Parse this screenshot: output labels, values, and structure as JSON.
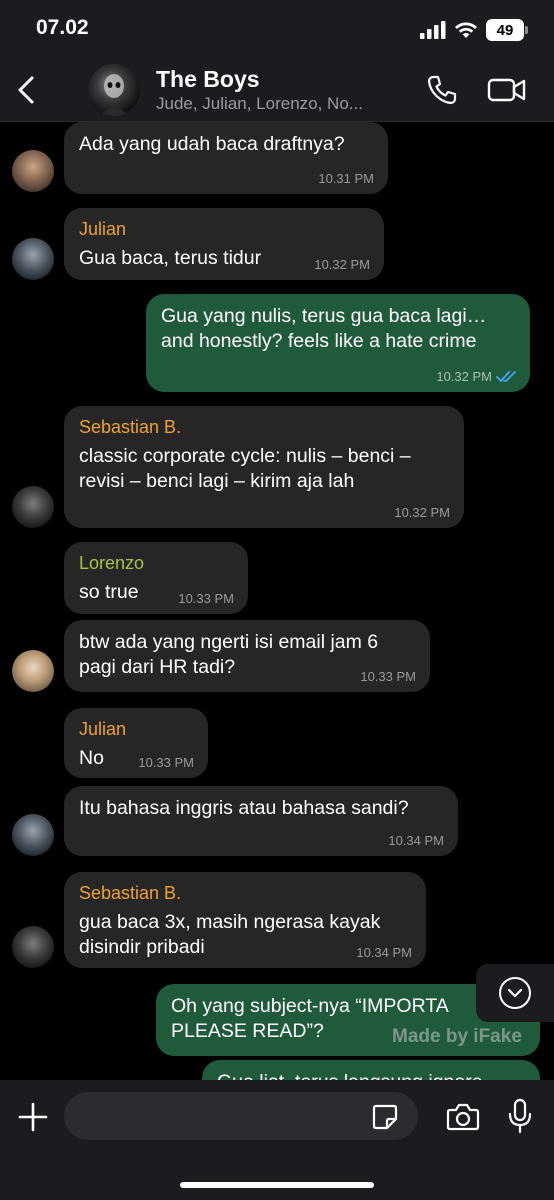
{
  "status_bar": {
    "time": "07.02",
    "battery": "49"
  },
  "header": {
    "title": "The Boys",
    "members": "Jude, Julian, Lorenzo, No..."
  },
  "messages": [
    {
      "sender": "",
      "text": "Ada yang udah baca draftnya?",
      "time": "10.31 PM",
      "direction": "in",
      "avatar": "jude"
    },
    {
      "sender": "Julian",
      "sender_color": "#f0a229",
      "text": "Gua baca, terus tidur",
      "time": "10.32 PM",
      "direction": "in",
      "avatar": "julian"
    },
    {
      "sender": "",
      "text": "Gua yang nulis, terus gua baca lagi…\nand honestly? feels like a hate crime",
      "time": "10.32 PM",
      "direction": "out",
      "read": true
    },
    {
      "sender": "Sebastian B.",
      "sender_color": "#f0a229",
      "text": "classic corporate cycle: nulis – benci –\nrevisi – benci lagi – kirim aja lah",
      "time": "10.32 PM",
      "direction": "in",
      "avatar": "sebastian"
    },
    {
      "sender": "Lorenzo",
      "sender_color": "#a8c43c",
      "text": "so true",
      "time": "10.33 PM",
      "direction": "in"
    },
    {
      "sender": "",
      "text": "btw ada yang ngerti isi email jam 6\npagi dari HR tadi?",
      "time": "10.33 PM",
      "direction": "in",
      "avatar": "unknown"
    },
    {
      "sender": "Julian",
      "sender_color": "#f0a229",
      "text": "No",
      "time": "10.33 PM",
      "direction": "in"
    },
    {
      "sender": "",
      "text": "Itu bahasa inggris atau bahasa sandi?",
      "time": "10.34 PM",
      "direction": "in",
      "avatar": "julian"
    },
    {
      "sender": "Sebastian B.",
      "sender_color": "#f0a229",
      "text": "gua baca 3x, masih ngerasa kayak\ndisindir pribadi",
      "time": "10.34 PM",
      "direction": "in",
      "avatar": "sebastian"
    },
    {
      "sender": "",
      "text": "Oh yang subject-nya “IMPORTA\nPLEASE READ”?",
      "time": "",
      "direction": "out"
    },
    {
      "sender": "",
      "text": "Gue liat, terus langsung ignore",
      "time": "",
      "direction": "out"
    }
  ],
  "watermark": "Made by iFake",
  "input": {
    "placeholder": ""
  },
  "icons": {
    "back": "chevron-left-icon",
    "call": "phone-icon",
    "video": "video-camera-icon",
    "plus": "plus-icon",
    "sticker": "sticker-icon",
    "camera": "camera-icon",
    "mic": "microphone-icon",
    "scroll": "chevron-down-circle-icon",
    "read": "double-check-icon"
  },
  "colors": {
    "incoming_bubble": "#262626",
    "outgoing_bubble": "#1f5a3a",
    "sender_orange": "#f0a229",
    "sender_green": "#a8c43c",
    "read_check": "#4fa3f7"
  }
}
